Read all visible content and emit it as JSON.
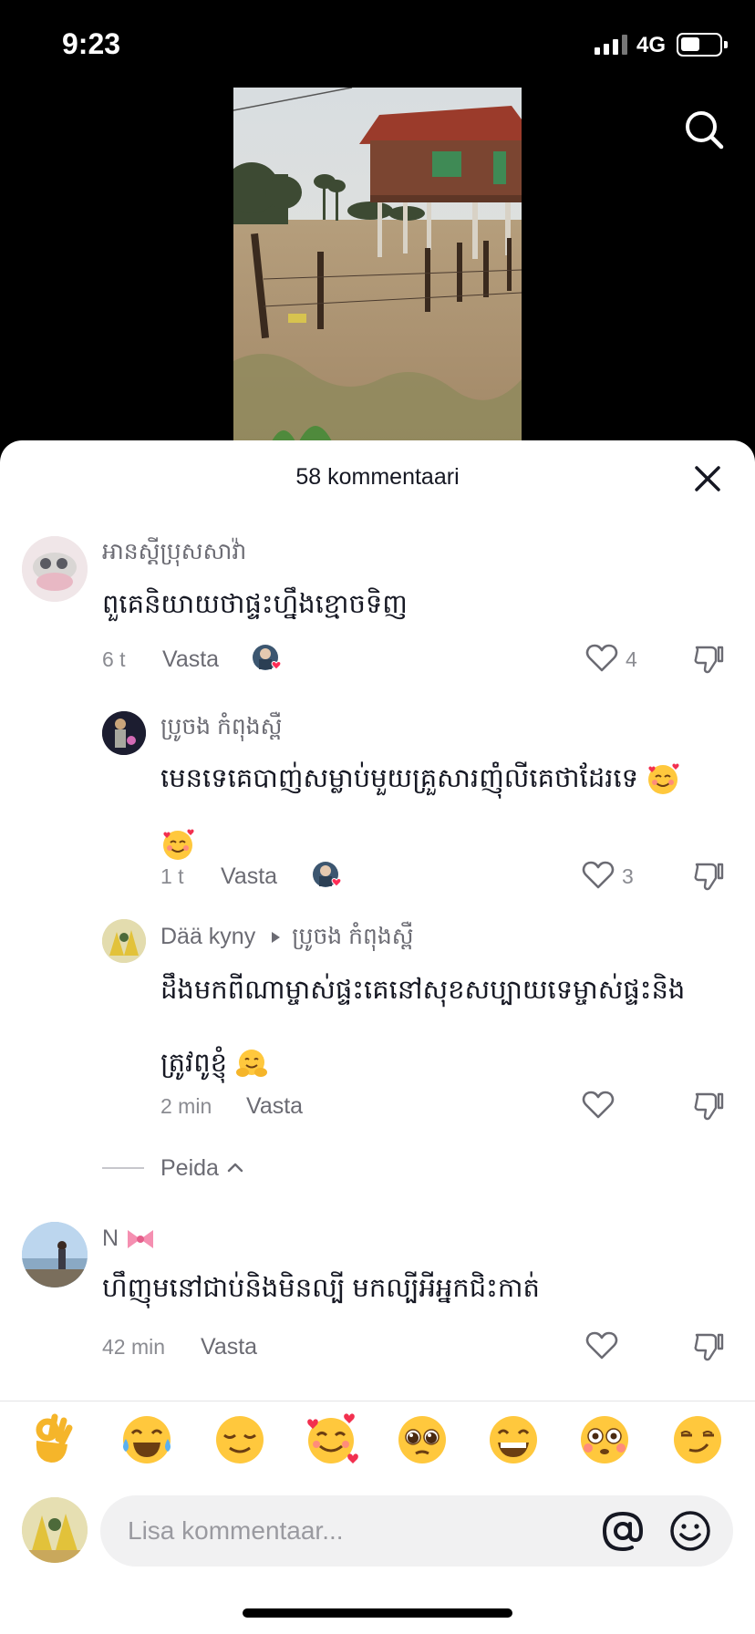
{
  "status_bar": {
    "time": "9:23",
    "network": "4G"
  },
  "sheet": {
    "title": "58 kommentaari"
  },
  "comments": [
    {
      "username": "អានស្តីប្រុសសាវ៉ា",
      "text": "ពួគេនិយាយថាផ្ទះហ្នឹងខ្មោចទិញ",
      "time": "6 t",
      "reply_label": "Vasta",
      "likes": "4"
    },
    {
      "username": "ប្រូចង កំពុងស្ពឺ",
      "text": "មេនទេគេបាញ់សម្លាប់មួយគ្រួសារញ៉ុំលីគេថាដែរទេ",
      "time": "1 t",
      "reply_label": "Vasta",
      "likes": "3"
    },
    {
      "username": "Dää kyny",
      "reply_to": "ប្រូចង កំពុងស្ពឺ",
      "text_line1": "ដឹងមកពីណាម្ចាស់ផ្ទះគេនៅសុខសប្បាយទេម្ចាស់ផ្ទះនិង",
      "text_line2": "ត្រូវពូខ្ញុំ",
      "time": "2 min",
      "reply_label": "Vasta"
    },
    {
      "username": "N",
      "text": "ហឹញុមនៅជាប់និងមិនល្បី មកល្បីអីអ្នកជិះកាត់",
      "time": "42 min",
      "reply_label": "Vasta"
    }
  ],
  "hide_replies_label": "Peida",
  "emoji_bar": [
    "ok-hand",
    "tears-of-joy",
    "relieved",
    "smiling-hearts",
    "pleading",
    "grinning",
    "flushed",
    "smirk"
  ],
  "comment_input": {
    "placeholder": "Lisa kommentaar..."
  }
}
